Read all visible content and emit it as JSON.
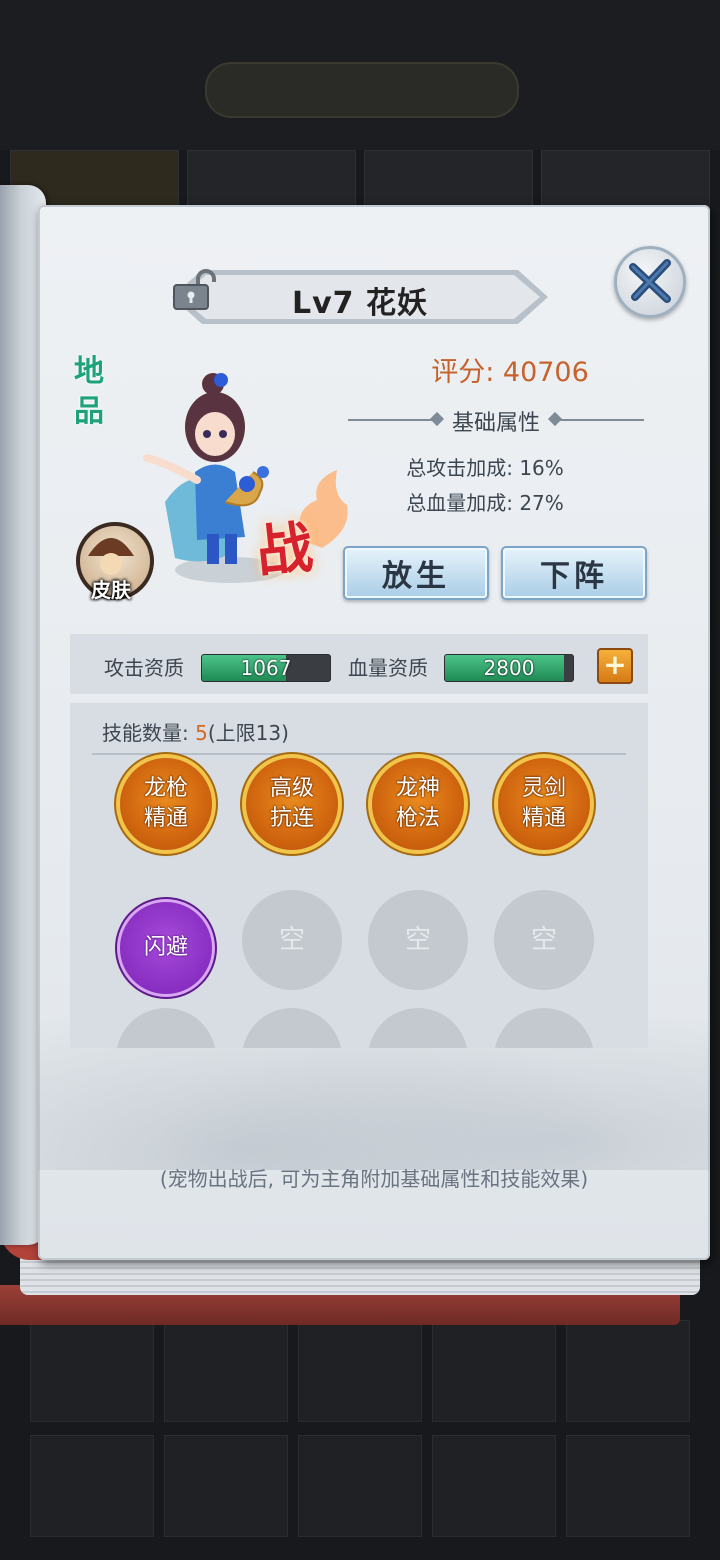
{
  "background": {
    "title": "",
    "tabs": [
      "",
      "",
      "",
      ""
    ]
  },
  "pet": {
    "title": "Lv7 花妖",
    "grade": "地品",
    "skin_label": "皮肤",
    "battle_mark": "战",
    "score_label": "评分: ",
    "score_value": "40706",
    "attr_title": "基础属性",
    "attrs": [
      {
        "label": "总攻击加成: ",
        "value": "16%"
      },
      {
        "label": "总血量加成: ",
        "value": "27%"
      }
    ],
    "release_label": "放生",
    "dismiss_label": "下阵"
  },
  "aptitude": {
    "attack_label": "攻击资质",
    "attack_value": "1067",
    "attack_fill": 0.66,
    "hp_label": "血量资质",
    "hp_value": "2800",
    "hp_fill": 0.93
  },
  "skills": {
    "count_label": "技能数量: ",
    "count_value": "5",
    "limit_text": "(上限13)",
    "items": [
      {
        "l1": "龙枪",
        "l2": "精通",
        "kind": "gold"
      },
      {
        "l1": "高级",
        "l2": "抗连",
        "kind": "gold"
      },
      {
        "l1": "龙神",
        "l2": "枪法",
        "kind": "gold"
      },
      {
        "l1": "灵剑",
        "l2": "精通",
        "kind": "gold"
      },
      {
        "l1": "闪避",
        "l2": "",
        "kind": "purple"
      },
      {
        "l1": "空",
        "l2": "",
        "kind": "empty"
      },
      {
        "l1": "空",
        "l2": "",
        "kind": "empty"
      },
      {
        "l1": "空",
        "l2": "",
        "kind": "empty"
      }
    ]
  },
  "footer_note": "(宠物出战后, 可为主角附加基础属性和技能效果)",
  "colors": {
    "score": "#c6622d",
    "grade": "#1ea27a",
    "skill_gold": "#d0650f",
    "skill_purple": "#7b23b8"
  }
}
